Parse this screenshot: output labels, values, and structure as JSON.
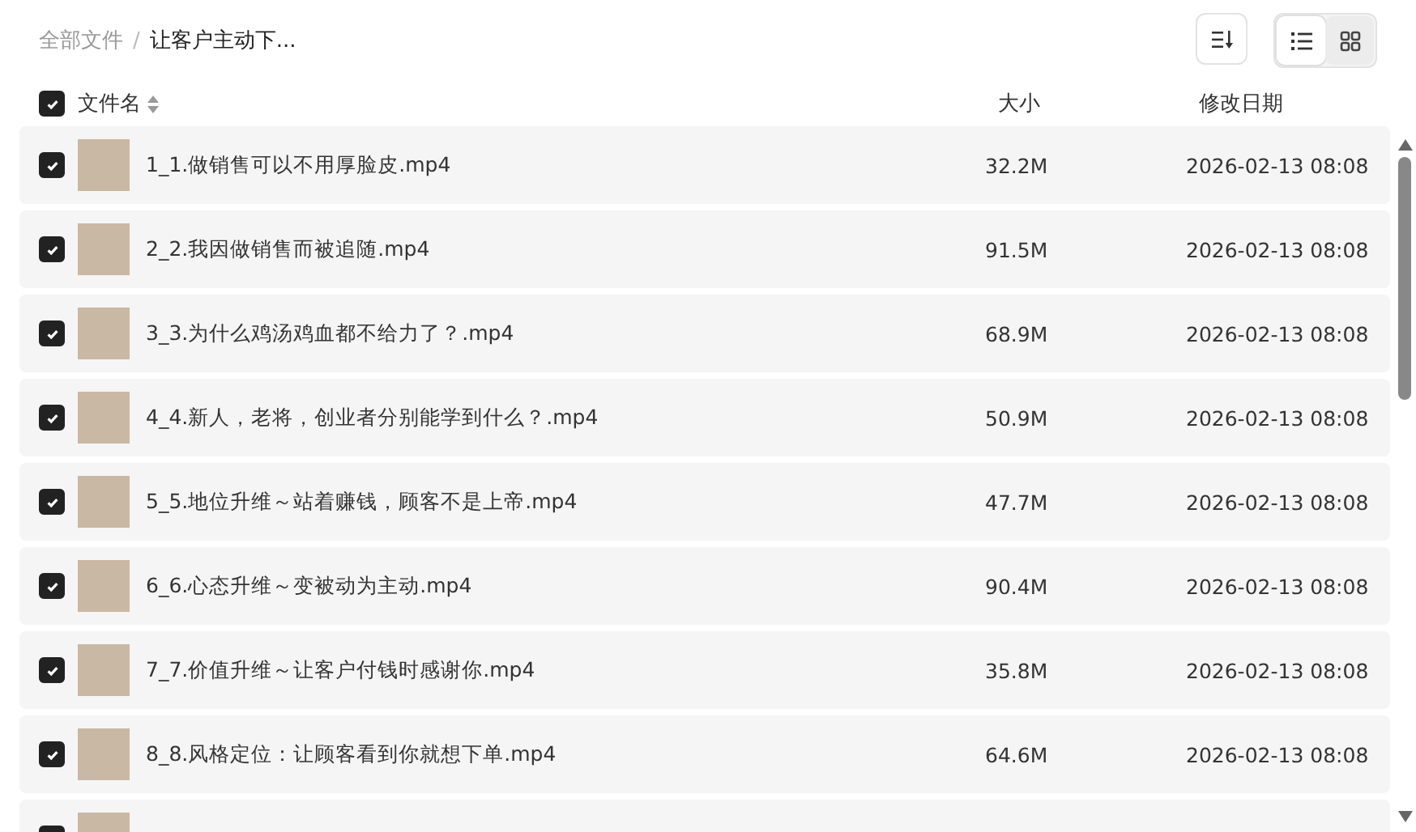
{
  "breadcrumb_separator": "/",
  "breadcrumb": [
    {
      "label": "全部文件",
      "current": false
    },
    {
      "label": "让客户主动下...",
      "current": true
    }
  ],
  "view_modes": [
    {
      "kind": "list",
      "selected": true
    },
    {
      "kind": "grid",
      "selected": false
    }
  ],
  "table": {
    "select_all_checked": true,
    "columns": [
      "文件名",
      "大小",
      "修改日期"
    ],
    "rows": [
      {
        "checked": true,
        "name": "1_1.做销售可以不用厚脸皮.mp4",
        "size": "32.2M",
        "modified": "2026-02-13 08:08"
      },
      {
        "checked": true,
        "name": "2_2.我因做销售而被追随.mp4",
        "size": "91.5M",
        "modified": "2026-02-13 08:08"
      },
      {
        "checked": true,
        "name": "3_3.为什么鸡汤鸡血都不给力了？.mp4",
        "size": "68.9M",
        "modified": "2026-02-13 08:08"
      },
      {
        "checked": true,
        "name": "4_4.新人，老将，创业者分别能学到什么？.mp4",
        "size": "50.9M",
        "modified": "2026-02-13 08:08"
      },
      {
        "checked": true,
        "name": "5_5.地位升维～站着赚钱，顾客不是上帝.mp4",
        "size": "47.7M",
        "modified": "2026-02-13 08:08"
      },
      {
        "checked": true,
        "name": "6_6.心态升维～变被动为主动.mp4",
        "size": "90.4M",
        "modified": "2026-02-13 08:08"
      },
      {
        "checked": true,
        "name": "7_7.价值升维～让客户付钱时感谢你.mp4",
        "size": "35.8M",
        "modified": "2026-02-13 08:08"
      },
      {
        "checked": true,
        "name": "8_8.风格定位：让顾客看到你就想下单.mp4",
        "size": "64.6M",
        "modified": "2026-02-13 08:08"
      },
      {
        "checked": true
      }
    ]
  }
}
